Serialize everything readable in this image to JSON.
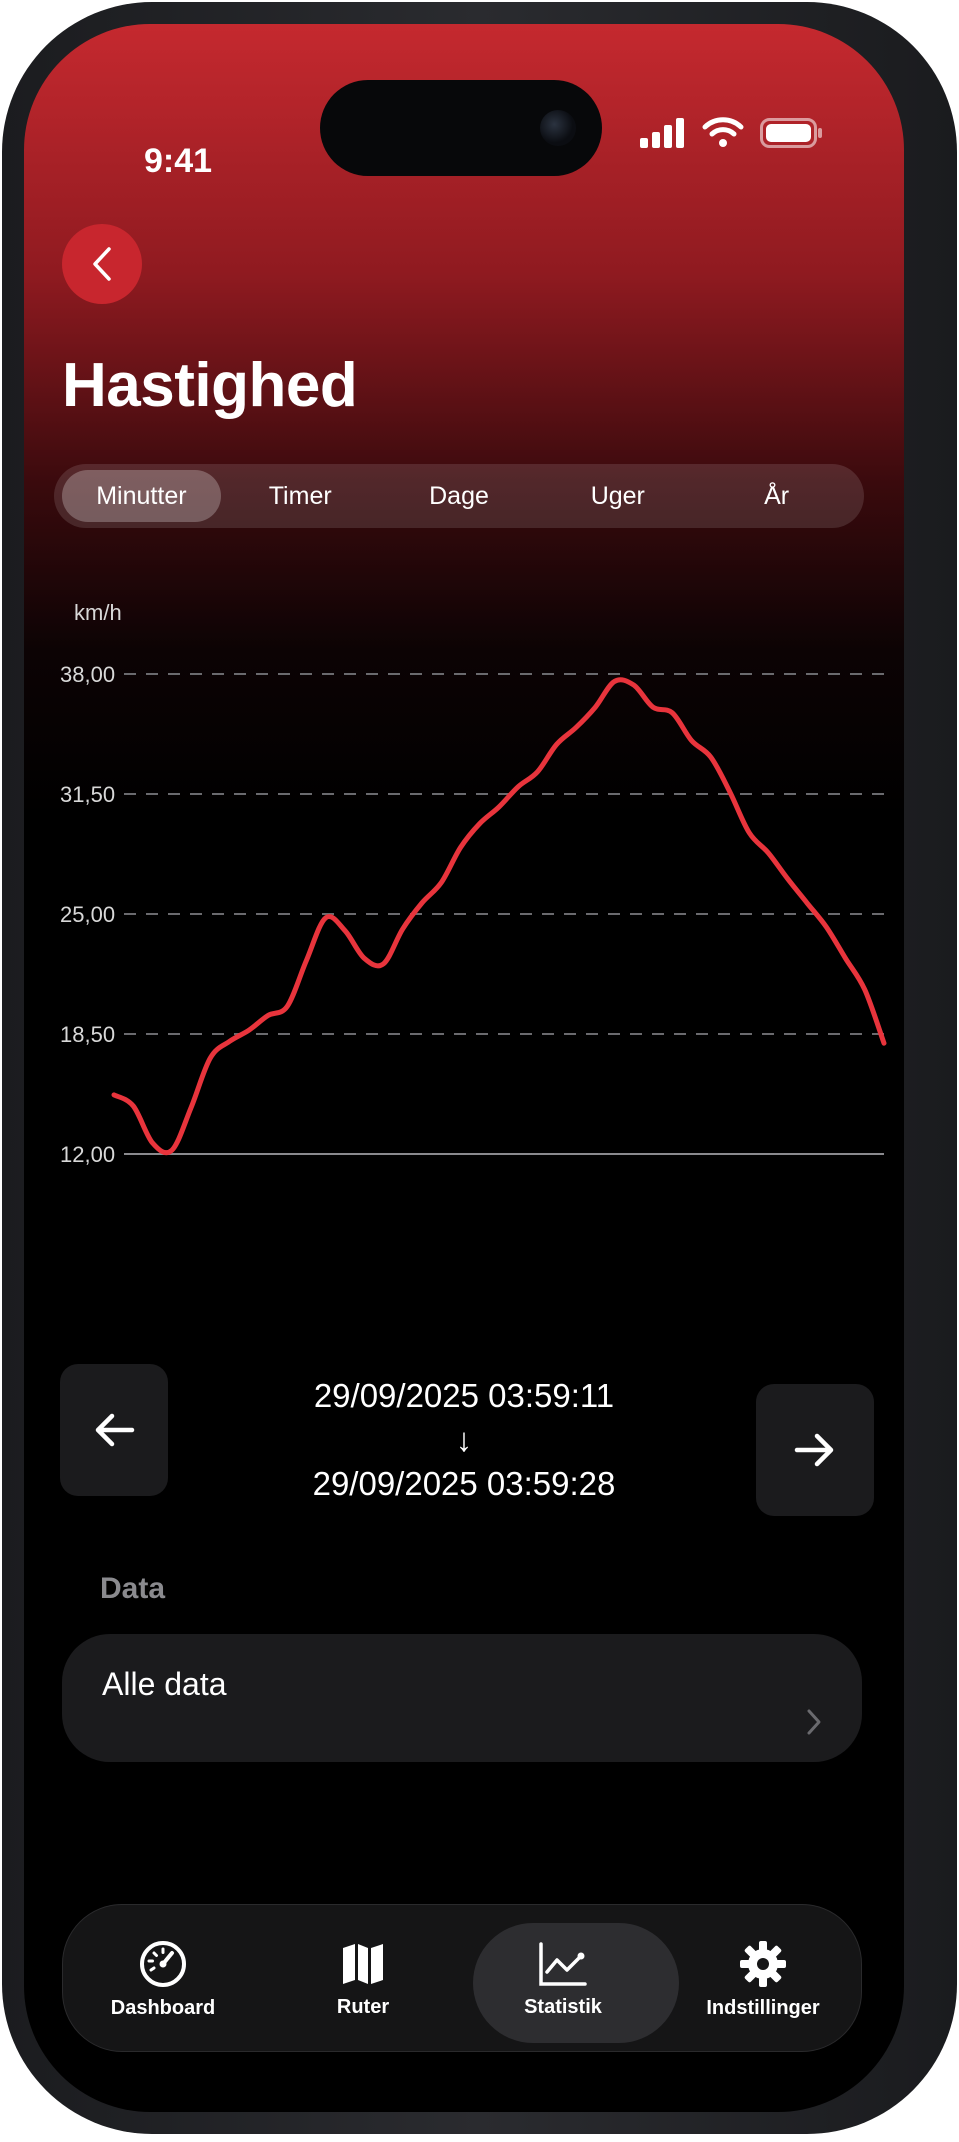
{
  "status_bar": {
    "time": "9:41"
  },
  "header": {
    "title": "Hastighed"
  },
  "segments": [
    {
      "label": "Minutter",
      "active": true
    },
    {
      "label": "Timer",
      "active": false
    },
    {
      "label": "Dage",
      "active": false
    },
    {
      "label": "Uger",
      "active": false
    },
    {
      "label": "År",
      "active": false
    }
  ],
  "chart_data": {
    "type": "line",
    "title": "",
    "ylabel": "km/h",
    "xlabel": "",
    "ylim": [
      12,
      38
    ],
    "y_ticks": [
      "38,00",
      "31,50",
      "25,00",
      "18,50",
      "12,00"
    ],
    "y_tick_values": [
      38,
      31.5,
      25,
      18.5,
      12
    ],
    "grid": "dashed horizontal",
    "legend": "none",
    "line_color": "#e8343c",
    "series": [
      {
        "x": [
          0,
          1,
          2,
          3,
          4,
          5,
          6,
          7,
          8,
          9,
          10,
          11,
          12,
          13,
          14,
          15,
          16,
          17,
          18,
          19,
          20,
          21,
          22,
          23,
          24,
          25,
          26,
          27,
          28,
          29,
          30,
          31,
          32,
          33,
          34,
          35,
          36,
          37,
          38,
          39,
          40
        ],
        "values": [
          15.2,
          14.6,
          12.6,
          12.2,
          14.5,
          17.2,
          18.1,
          18.7,
          19.5,
          20.0,
          22.5,
          24.8,
          24.1,
          22.6,
          22.3,
          24.2,
          25.6,
          26.7,
          28.6,
          29.9,
          30.8,
          31.9,
          32.7,
          34.2,
          35.1,
          36.2,
          37.6,
          37.4,
          36.2,
          35.9,
          34.4,
          33.5,
          31.6,
          29.4,
          28.3,
          26.9,
          25.6,
          24.3,
          22.6,
          20.9,
          18.0
        ]
      }
    ]
  },
  "pager": {
    "range_start": "29/09/2025 03:59:11",
    "range_arrow": "↓",
    "range_end": "29/09/2025 03:59:28"
  },
  "data_section": {
    "label": "Data",
    "row_label": "Alle data"
  },
  "tabbar": [
    {
      "label": "Dashboard",
      "icon": "speedometer-icon",
      "active": false
    },
    {
      "label": "Ruter",
      "icon": "map-icon",
      "active": false
    },
    {
      "label": "Statistik",
      "icon": "chart-icon",
      "active": true
    },
    {
      "label": "Indstillinger",
      "icon": "gear-icon",
      "active": false
    }
  ],
  "colors": {
    "accent": "#c8262e",
    "line": "#e8343c",
    "card": "#1b1b1d",
    "muted": "#8a8a8e"
  }
}
